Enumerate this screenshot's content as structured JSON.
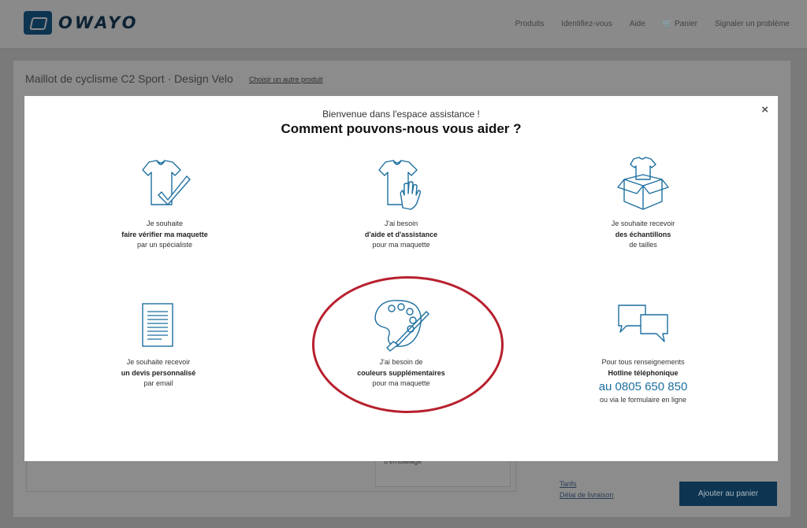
{
  "header": {
    "brand": "OWAYO",
    "nav": [
      "Produits",
      "Identifiez-vous",
      "Aide",
      "Panier",
      "Signaler un problème"
    ]
  },
  "background_page": {
    "title": "Maillot de cyclisme C2 Sport · Design Velo",
    "change_link": "Choisir un autre produit",
    "card_text": "d'emballage",
    "links": [
      "Tarifs",
      "Délai de livraison"
    ],
    "add_to_cart": "Ajouter au panier"
  },
  "modal": {
    "close": "×",
    "welcome": "Bienvenue dans l'espace assistance !",
    "heading": "Comment pouvons-nous vous aider ?",
    "options": [
      {
        "line1": "Je souhaite",
        "line2": "faire vérifier ma maquette",
        "line3": "par un spécialiste",
        "icon": "shirt-check-icon"
      },
      {
        "line1": "J'ai besoin",
        "line2": "d'aide et d'assistance",
        "line3": "pour ma maquette",
        "icon": "shirt-hand-icon"
      },
      {
        "line1": "Je souhaite recevoir",
        "line2": "des échantillons",
        "line3": "de tailles",
        "icon": "shirt-box-icon"
      },
      {
        "line1": "Je souhaite recevoir",
        "line2": "un devis personnalisé",
        "line3": "par email",
        "icon": "document-icon"
      },
      {
        "line1": "J'ai besoin de",
        "line2": "couleurs supplémentaires",
        "line3": "pour ma maquette",
        "icon": "palette-icon"
      },
      {
        "line1": "Pour tous renseignements",
        "line2": "Hotline téléphonique",
        "phone": "au 0805 650 850",
        "line3": "ou via le formulaire en ligne",
        "icon": "chat-bubbles-icon"
      }
    ]
  },
  "colors": {
    "icon_blue": "#1d6f9f",
    "brand_navy": "#0d3551",
    "highlight_red": "#b8202e"
  }
}
